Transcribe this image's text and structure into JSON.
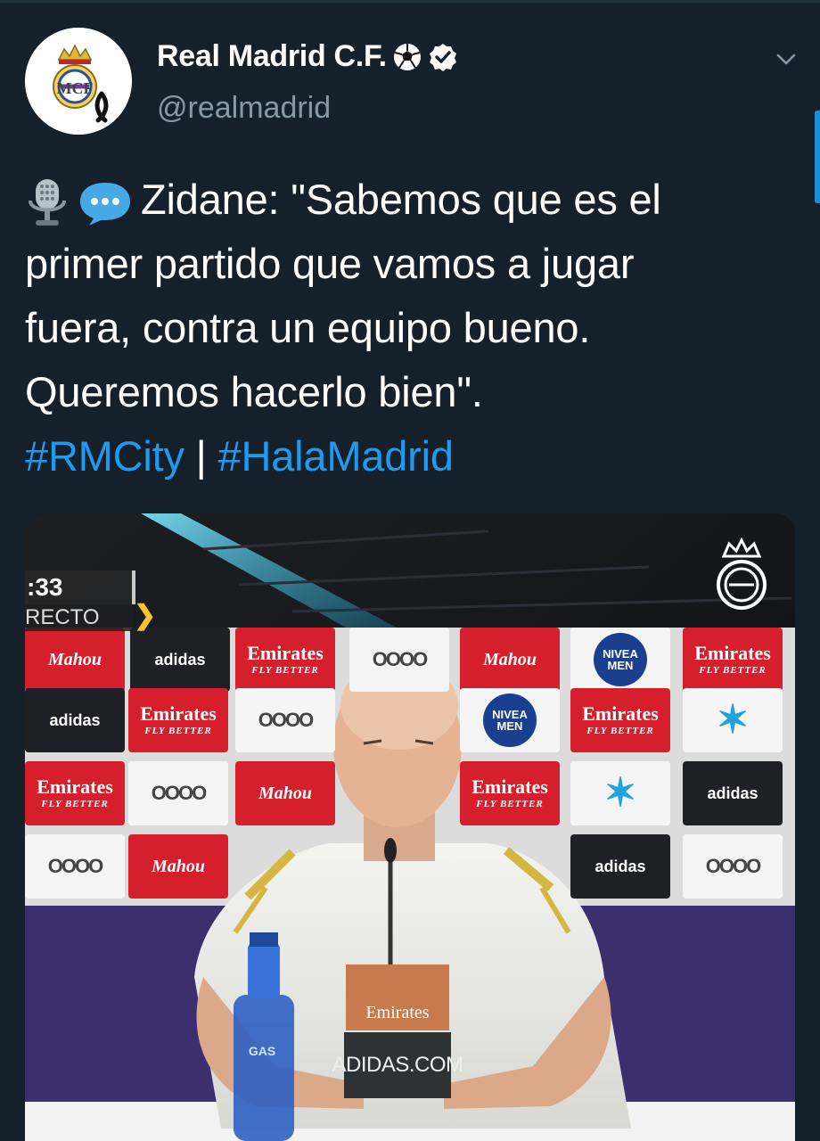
{
  "tweet": {
    "display_name": "Real Madrid C.F.",
    "handle": "@realmadrid",
    "verified": true,
    "text_lines": [
      "Zidane: \"Sabemos que es el",
      "primer partido que vamos a jugar",
      "fuera, contra un equipo bueno.",
      "Queremos hacerlo bien\"."
    ],
    "hashtags": [
      "#RMCity",
      "#HalaMadrid"
    ],
    "hashtag_separator": "|",
    "emojis": [
      "microphone-icon",
      "speech-bubble-icon"
    ]
  },
  "video": {
    "live_time": ":33",
    "live_label": "RECTO",
    "table_sign_top": "Emirates",
    "table_sign_bottom": "ADIDAS.COM",
    "bottle_label": "GAS",
    "sponsors": {
      "emirates": "Emirates",
      "emirates_sub": "FLY BETTER",
      "mahou": "Mahou",
      "audi": "OOOO",
      "adidas": "adidas",
      "nivea": "NIVEA",
      "nivea_sub": "MEN"
    }
  },
  "colors": {
    "background": "#15202b",
    "link": "#1d9bf0",
    "secondary_text": "#8899a6"
  }
}
